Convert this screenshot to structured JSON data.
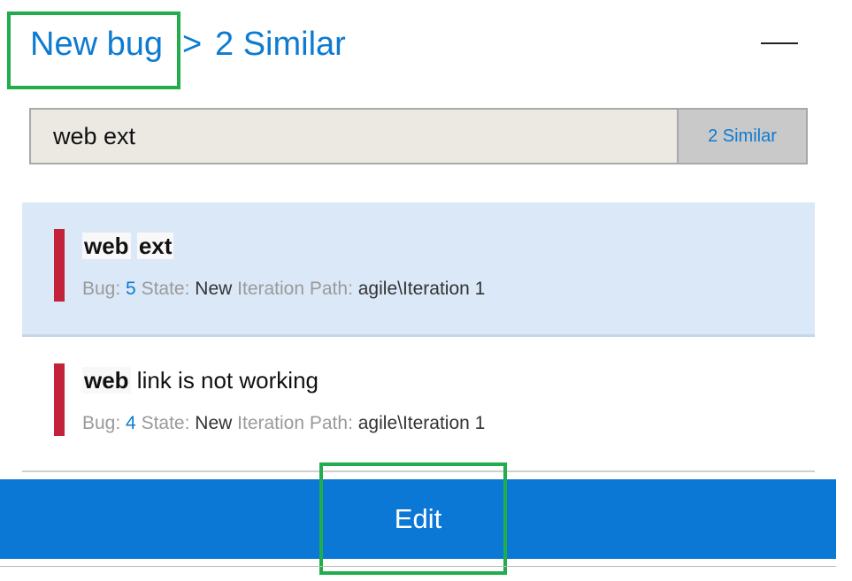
{
  "breadcrumb": {
    "root": "New bug",
    "separator": ">",
    "current": "2 Similar"
  },
  "search": {
    "value": "web ext",
    "similar_button": "2 Similar"
  },
  "results": [
    {
      "title_terms": [
        "web",
        "ext"
      ],
      "title_rest": "",
      "bug_label": "Bug:",
      "bug_id": "5",
      "state_label": "State:",
      "state": "New",
      "path_label": "Iteration Path:",
      "path": "agile\\Iteration 1"
    },
    {
      "title_terms": [
        "web"
      ],
      "title_rest": " link is not working",
      "bug_label": "Bug:",
      "bug_id": "4",
      "state_label": "State:",
      "state": "New",
      "path_label": "Iteration Path:",
      "path": "agile\\Iteration 1"
    }
  ],
  "footer": {
    "edit_label": "Edit"
  },
  "colors": {
    "accent": "#0c78d6",
    "link": "#0c7bd1",
    "status_bar": "#c4213b",
    "selected_bg": "#dbe8f8",
    "highlight": "#21ad4b"
  }
}
